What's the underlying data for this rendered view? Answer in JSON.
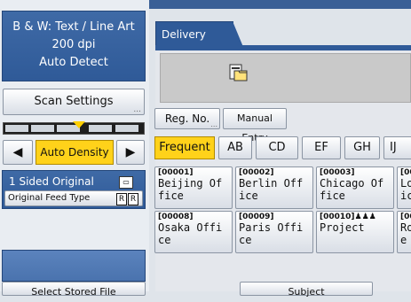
{
  "left_panel": {
    "mode": {
      "line1": "B & W: Text / Line Art",
      "line2": "200 dpi",
      "line3": "Auto Detect"
    },
    "scan_settings_label": "Scan Settings",
    "scan_settings_more": "...",
    "density": {
      "left_arrow": "◀",
      "auto_label": "Auto Density",
      "right_arrow": "▶"
    },
    "original": {
      "sided_label": "1 Sided Original",
      "feed_label": "Original Feed Type",
      "feed_icon1": "R",
      "feed_icon2": "R"
    },
    "select_stored_label": "Select Stored File"
  },
  "main": {
    "tab_label": "Delivery Server",
    "reg_no_label": "Reg. No.",
    "reg_no_more": "...",
    "manual_entry_label": "Manual Entry",
    "index_tabs": [
      "Frequent",
      "AB",
      "CD",
      "EF",
      "GH",
      "IJ"
    ],
    "destinations": [
      {
        "num": "[00001]",
        "line1": "Beijing Of",
        "line2": "fice"
      },
      {
        "num": "[00002]",
        "line1": "Berlin Off",
        "line2": "ice"
      },
      {
        "num": "[00003]",
        "line1": "Chicago Of",
        "line2": "fice"
      },
      {
        "num": "[00",
        "line1": "Lo",
        "line2": "ic"
      },
      {
        "num": "[00008]",
        "line1": "Osaka Offi",
        "line2": "ce"
      },
      {
        "num": "[00009]",
        "line1": "Paris Offi",
        "line2": "ce"
      },
      {
        "num": "[00010]",
        "line1": "Project",
        "line2": ""
      },
      {
        "num": "[00",
        "line1": "Ro",
        "line2": "e"
      }
    ],
    "subject_label": "Subject"
  },
  "colors": {
    "panel_blue": "#2f5a98",
    "highlight_yellow": "#ffd21a"
  }
}
